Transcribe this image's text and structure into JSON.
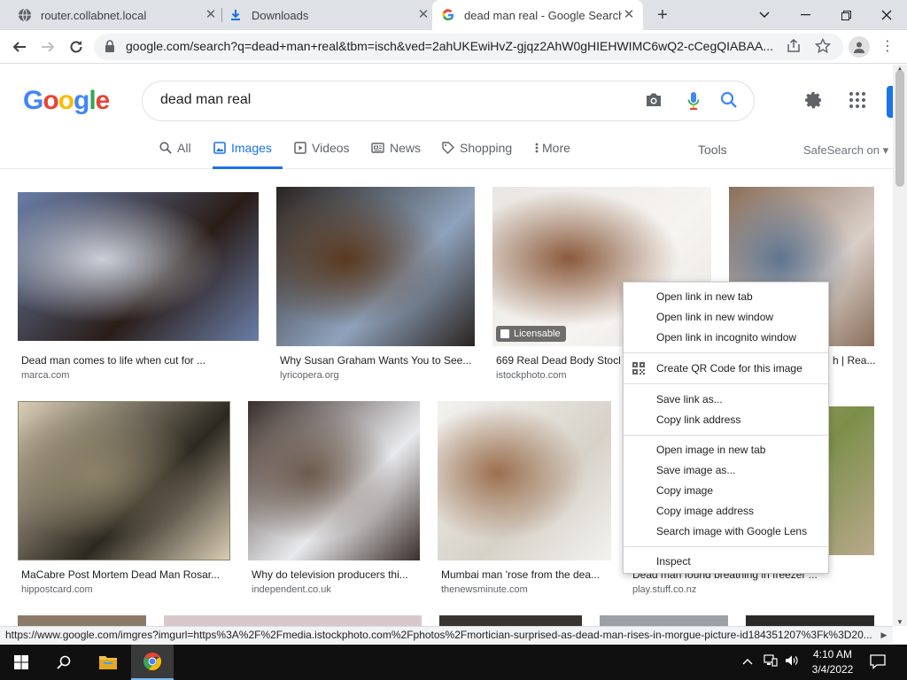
{
  "browser": {
    "tabs": [
      {
        "title": "router.collabnet.local",
        "icon": "globe-icon"
      },
      {
        "title": "Downloads",
        "icon": "download-icon"
      },
      {
        "title": "dead man real - Google Search",
        "icon": "google-icon",
        "active": true
      }
    ],
    "new_tab_label": "+",
    "url": "google.com/search?q=dead+man+real&tbm=isch&ved=2ahUKEwiHvZ-gjqz2AhW0gHIEHWIMC6wQ2-cCegQIABAA..."
  },
  "google": {
    "logo_text": "Google",
    "logo_letters": [
      "G",
      "o",
      "o",
      "g",
      "l",
      "e"
    ],
    "logo_colors": [
      "#4285f4",
      "#ea4335",
      "#fbbc05",
      "#4285f4",
      "#34a853",
      "#ea4335"
    ],
    "query": "dead man real",
    "tabs": [
      {
        "label": "All",
        "icon": "search-icon"
      },
      {
        "label": "Images",
        "icon": "image-icon",
        "active": true
      },
      {
        "label": "Videos",
        "icon": "play-icon"
      },
      {
        "label": "News",
        "icon": "newspaper-icon"
      },
      {
        "label": "Shopping",
        "icon": "tag-icon"
      },
      {
        "label": "More",
        "icon": "dots-vertical-icon"
      }
    ],
    "tools_label": "Tools",
    "safesearch_label": "SafeSearch on ▾"
  },
  "results": [
    {
      "caption": "Dead man comes to life when cut for ...",
      "domain": "marca.com",
      "colors": [
        "#6a7ea8",
        "#2a1d18",
        "#c9cfd8"
      ]
    },
    {
      "caption": "Why Susan Graham Wants You to See...",
      "domain": "lyricopera.org",
      "colors": [
        "#2a2420",
        "#8fa3bd",
        "#5a3a20"
      ]
    },
    {
      "caption": "669 Real Dead Body Stock Ph...",
      "domain": "istockphoto.com",
      "colors": [
        "#e9e6e2",
        "#f6f4f1",
        "#8a5a3c"
      ],
      "badge": "Licensable"
    },
    {
      "caption": "h | Rea...",
      "domain": "",
      "colors": [
        "#8a6f5c",
        "#d9cfc8",
        "#5f7590"
      ]
    },
    {
      "caption": "MaCabre Post Mortem Dead Man Rosar...",
      "domain": "hippostcard.com",
      "colors": [
        "#d9cdb4",
        "#2c2820",
        "#8c8268"
      ]
    },
    {
      "caption": "Why do television producers thi...",
      "domain": "independent.co.uk",
      "colors": [
        "#3a2e2a",
        "#e8e9ec",
        "#6c5a4d"
      ]
    },
    {
      "caption": "Mumbai man 'rose from the dea...",
      "domain": "thenewsminute.com",
      "colors": [
        "#f2f2f0",
        "#d7d2c8",
        "#9b6f4f"
      ]
    },
    {
      "caption": "Dead man found breathing in freezer ...",
      "domain": "play.stuff.co.nz",
      "colors": [
        "#b9a98c",
        "#7c8f4a",
        "#d8d4c6"
      ]
    }
  ],
  "context_menu": {
    "items": [
      "Open link in new tab",
      "Open link in new window",
      "Open link in incognito window",
      "Create QR Code for this image",
      "Save link as...",
      "Copy link address",
      "Open image in new tab",
      "Save image as...",
      "Copy image",
      "Copy image address",
      "Search image with Google Lens",
      "Inspect"
    ]
  },
  "status_url": "https://www.google.com/imgres?imgurl=https%3A%2F%2Fmedia.istockphoto.com%2Fphotos%2Fmortician-surprised-as-dead-man-rises-in-morgue-picture-id184351207%3Fk%3D20...",
  "taskbar": {
    "time": "4:10 AM",
    "date": "3/4/2022",
    "pinned": [
      "windows-start-icon",
      "search-icon",
      "file-explorer-icon",
      "chrome-icon"
    ]
  }
}
